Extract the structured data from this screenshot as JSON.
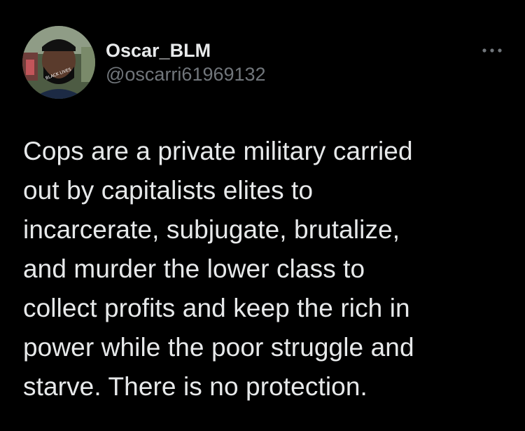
{
  "tweet": {
    "author": {
      "display_name": "Oscar_BLM",
      "handle": "@oscarri61969132",
      "avatar_mask_text": "BLACK LIVES MATTER"
    },
    "more_icon": "more-horizontal-icon",
    "text": "Cops are a private military carried\nout by capitalists elites to\nincarcerate, subjugate, brutalize,\nand murder the lower class to\ncollect profits and keep the rich in\npower while the poor struggle and\nstarve. There is no protection."
  },
  "colors": {
    "background": "#000000",
    "primary_text": "#e7e9ea",
    "secondary_text": "#71767b"
  }
}
